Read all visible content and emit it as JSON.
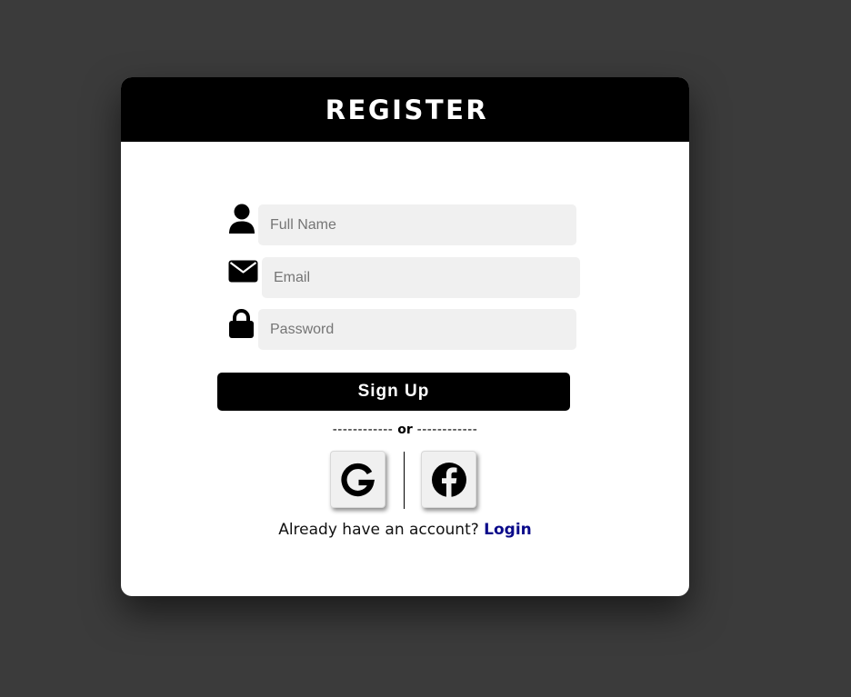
{
  "form": {
    "title": "REGISTER",
    "fields": [
      {
        "name": "full-name",
        "placeholder": "Full Name",
        "value": "",
        "icon": "user-icon"
      },
      {
        "name": "email",
        "placeholder": "Email",
        "value": "",
        "icon": "envelope-icon"
      },
      {
        "name": "password",
        "placeholder": "Password",
        "value": "",
        "icon": "lock-icon"
      }
    ],
    "submit_label": "Sign Up",
    "divider": {
      "dashes_left": "------------",
      "text": "or",
      "dashes_right": "------------"
    },
    "social": [
      {
        "icon": "google-icon"
      },
      {
        "icon": "facebook-icon"
      }
    ],
    "footer": {
      "prompt": "Already have an account?",
      "link_label": "Login"
    }
  },
  "colors": {
    "background": "#3b3b3b",
    "header": "#000000",
    "card": "#ffffff",
    "input_bg": "#f0f0f0",
    "link": "#0a0a8a"
  }
}
